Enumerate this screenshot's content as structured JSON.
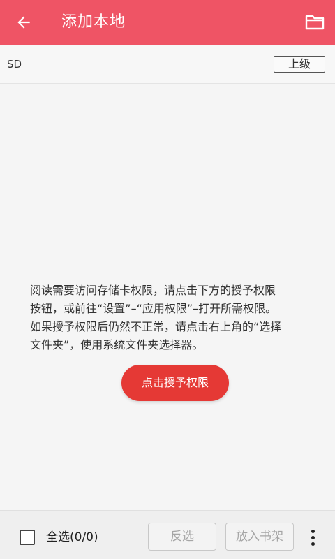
{
  "header": {
    "title": "添加本地",
    "back_icon": "arrow-left-icon",
    "folder_icon": "folder-icon",
    "color": "#ef5465"
  },
  "pathbar": {
    "path": "SD",
    "up_label": "上级"
  },
  "message": {
    "lines": [
      "阅读需要访问存储卡权限，请点击下方的授予权限",
      "按钮，或前往“设置”–“应用权限”–打开所需权限。",
      "如果授予权限后仍然不正常，请点击右上角的“选择",
      "文件夹”，使用系统文件夹选择器。"
    ]
  },
  "grant_button": {
    "label": "点击授予权限",
    "color": "#e53935"
  },
  "bottombar": {
    "select_all_label": "全选(0/0)",
    "invert_label": "反选",
    "add_to_shelf_label": "放入书架",
    "more_icon": "more-vertical-icon"
  }
}
